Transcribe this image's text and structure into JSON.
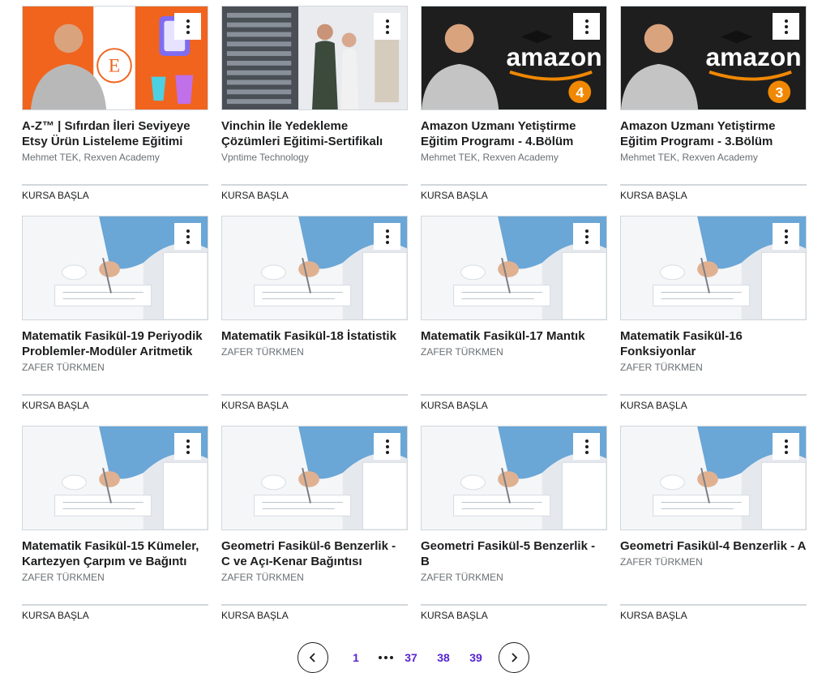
{
  "courses": [
    {
      "title": "A-Z™ | Sıfırdan İleri Seviyeye Etsy Ürün Listeleme Eğitimi",
      "instructor": "Mehmet TEK, Rexven Academy",
      "cta": "KURSA BAŞLA",
      "thumb": "etsy",
      "badge": "E"
    },
    {
      "title": "Vinchin İle Yedekleme Çözümleri Eğitimi-Sertifikalı",
      "instructor": "Vpntime Technology",
      "cta": "KURSA BAŞLA",
      "thumb": "datacenter"
    },
    {
      "title": "Amazon Uzmanı Yetiştirme Eğitim Programı - 4.Bölüm",
      "instructor": "Mehmet TEK, Rexven Academy",
      "cta": "KURSA BAŞLA",
      "thumb": "amazon",
      "badge": "4",
      "logo": "amazon"
    },
    {
      "title": "Amazon Uzmanı Yetiştirme Eğitim Programı - 3.Bölüm",
      "instructor": "Mehmet TEK, Rexven Academy",
      "cta": "KURSA BAŞLA",
      "thumb": "amazon",
      "badge": "3",
      "logo": "amazon"
    },
    {
      "title": "Matematik Fasikül-19 Periyodik Problemler-Modüler Aritmetik",
      "instructor": "ZAFER TÜRKMEN",
      "cta": "KURSA BAŞLA",
      "thumb": "writing"
    },
    {
      "title": "Matematik Fasikül-18 İstatistik",
      "instructor": "ZAFER TÜRKMEN",
      "cta": "KURSA BAŞLA",
      "thumb": "writing"
    },
    {
      "title": "Matematik Fasikül-17 Mantık",
      "instructor": "ZAFER TÜRKMEN",
      "cta": "KURSA BAŞLA",
      "thumb": "writing"
    },
    {
      "title": "Matematik Fasikül-16 Fonksiyonlar",
      "instructor": "ZAFER TÜRKMEN",
      "cta": "KURSA BAŞLA",
      "thumb": "writing"
    },
    {
      "title": "Matematik Fasikül-15 Kümeler, Kartezyen Çarpım ve Bağıntı",
      "instructor": "ZAFER TÜRKMEN",
      "cta": "KURSA BAŞLA",
      "thumb": "writing"
    },
    {
      "title": "Geometri Fasikül-6 Benzerlik - C ve Açı-Kenar Bağıntısı",
      "instructor": "ZAFER TÜRKMEN",
      "cta": "KURSA BAŞLA",
      "thumb": "writing"
    },
    {
      "title": "Geometri Fasikül-5 Benzerlik - B",
      "instructor": "ZAFER TÜRKMEN",
      "cta": "KURSA BAŞLA",
      "thumb": "writing"
    },
    {
      "title": "Geometri Fasikül-4 Benzerlik - A",
      "instructor": "ZAFER TÜRKMEN",
      "cta": "KURSA BAŞLA",
      "thumb": "writing"
    }
  ],
  "pagination": {
    "prev_icon": "chevron-left-icon",
    "next_icon": "chevron-right-icon",
    "pages": [
      "1",
      "37",
      "38",
      "39"
    ],
    "ellipsis_icon": "more-horizontal-icon"
  },
  "colors": {
    "link": "#5624d0",
    "etsy_orange": "#f1641e",
    "amazon_orange": "#f08804",
    "divider": "#d1d7dc"
  }
}
